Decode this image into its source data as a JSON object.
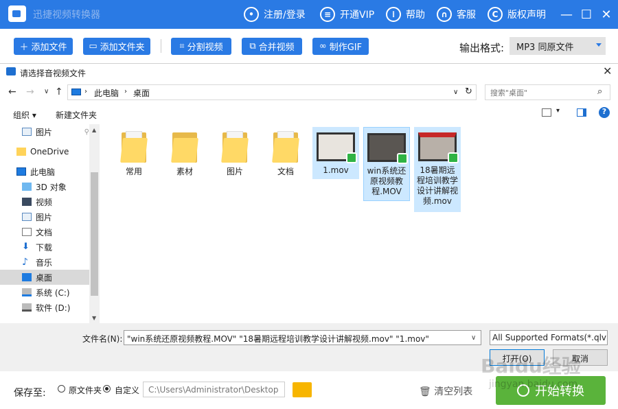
{
  "app": {
    "title": "迅捷视频转换器",
    "login": "注册/登录",
    "vip": "开通VIP",
    "help": "帮助",
    "service": "客服",
    "copyright": "版权声明"
  },
  "toolbar": {
    "add_file": "添加文件",
    "add_folder": "添加文件夹",
    "split": "分割视频",
    "merge": "合并视频",
    "gif": "制作GIF",
    "format_label": "输出格式:",
    "format_value": "MP3  同原文件"
  },
  "dialog": {
    "title": "请选择音视频文件",
    "crumbs": [
      "此电脑",
      "桌面"
    ],
    "search_placeholder": "搜索\"桌面\"",
    "organize": "组织 ▾",
    "new_folder": "新建文件夹",
    "nav": [
      "图片",
      "OneDrive",
      "此电脑",
      "3D 对象",
      "视频",
      "图片",
      "文档",
      "下载",
      "音乐",
      "桌面",
      "系统 (C:)",
      "软件 (D:)"
    ],
    "files": [
      "常用",
      "素材",
      "图片",
      "文档",
      "1.mov",
      "win系统还原视频教程.MOV",
      "18暑期远程培训教学设计讲解视频.mov"
    ],
    "filename_label": "文件名(N):",
    "filename_value": "\"win系统还原视频教程.MOV\" \"18暑期远程培训教学设计讲解视频.mov\" \"1.mov\"",
    "filter": "All Supported Formats(*.qlv;",
    "open": "打开(O)",
    "cancel": "取消"
  },
  "footer": {
    "save_label": "保存至:",
    "opt_original": "原文件夹",
    "opt_custom": "自定义",
    "path": "C:\\Users\\Administrator\\Desktop",
    "clear": "清空列表",
    "start": "开始转换"
  },
  "watermark": {
    "text": "Baidu经验",
    "url": "jingyan.baidu.com"
  },
  "colors": {
    "brand": "#2a7ae4",
    "start": "#5ab33b",
    "selection": "#cce8ff"
  }
}
